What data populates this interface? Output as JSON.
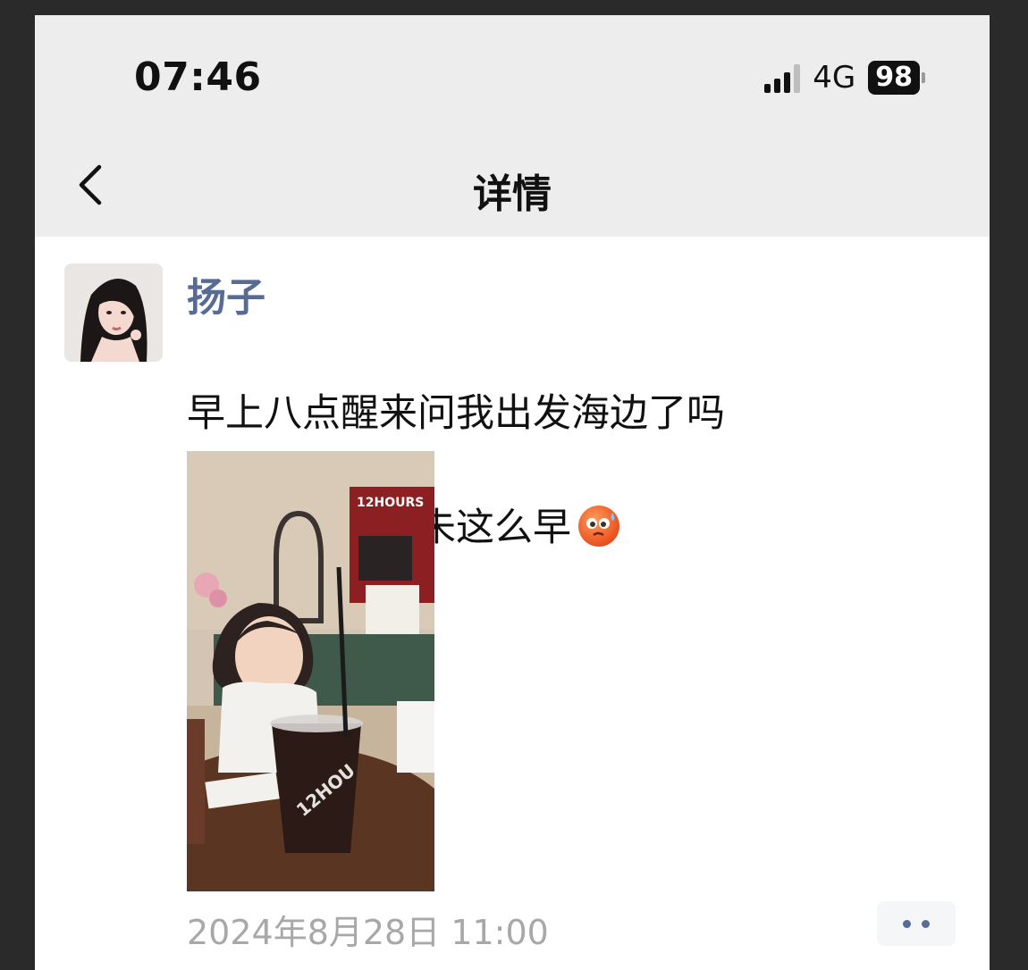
{
  "status_bar": {
    "time": "07:46",
    "network": "4G",
    "battery": "98"
  },
  "nav": {
    "title": "详情",
    "back_icon": "chevron-left-icon"
  },
  "post": {
    "author": "扬子",
    "text_line1": "早上八点醒来问我出发海边了吗",
    "text_line2": "上幼儿园也从未这么早",
    "emoji": "sweating-face-emoji",
    "photo_text": "12HOURS",
    "cup_text": "12HOU",
    "timestamp": "2024年8月28日 11:00",
    "more_icon": "more-dots-icon"
  },
  "colors": {
    "author_link": "#576b95",
    "nav_bg": "#ededed",
    "timestamp": "#a8a8a8"
  }
}
